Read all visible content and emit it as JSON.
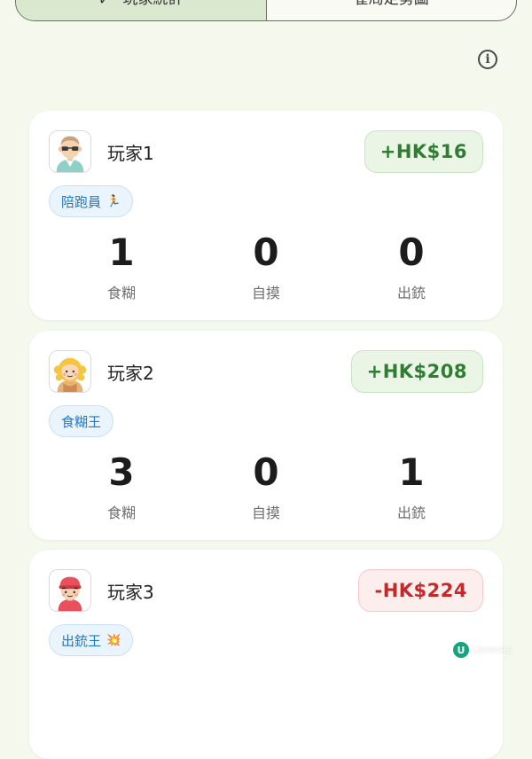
{
  "tabs": [
    {
      "label": "玩家統計",
      "active": true
    },
    {
      "label": "雀局走勢圖",
      "active": false
    }
  ],
  "info_icon": "info-icon",
  "players": [
    {
      "name": "玩家1",
      "amount": "+HK$16",
      "amount_sign": "positive",
      "badge": "陪跑員",
      "badge_emoji": "🏃",
      "avatar": "old-man-glasses-avatar",
      "stats": [
        {
          "value": "1",
          "label": "食糊"
        },
        {
          "value": "0",
          "label": "自摸"
        },
        {
          "value": "0",
          "label": "出銃"
        }
      ]
    },
    {
      "name": "玩家2",
      "amount": "+HK$208",
      "amount_sign": "positive",
      "badge": "食糊王",
      "badge_emoji": "",
      "avatar": "blonde-girl-avatar",
      "stats": [
        {
          "value": "3",
          "label": "食糊"
        },
        {
          "value": "0",
          "label": "自摸"
        },
        {
          "value": "1",
          "label": "出銃"
        }
      ]
    },
    {
      "name": "玩家3",
      "amount": "-HK$224",
      "amount_sign": "negative",
      "badge": "出銃王",
      "badge_emoji": "💥",
      "avatar": "boy-red-cap-avatar"
    }
  ],
  "colors": {
    "background": "#f4f8ed",
    "positive": "#2f7d32",
    "negative": "#c62828",
    "badge_text": "#1f78c8",
    "active_tab": "#d9e8cf"
  },
  "watermark": {
    "logo": "U",
    "text": "UNWIRE"
  }
}
